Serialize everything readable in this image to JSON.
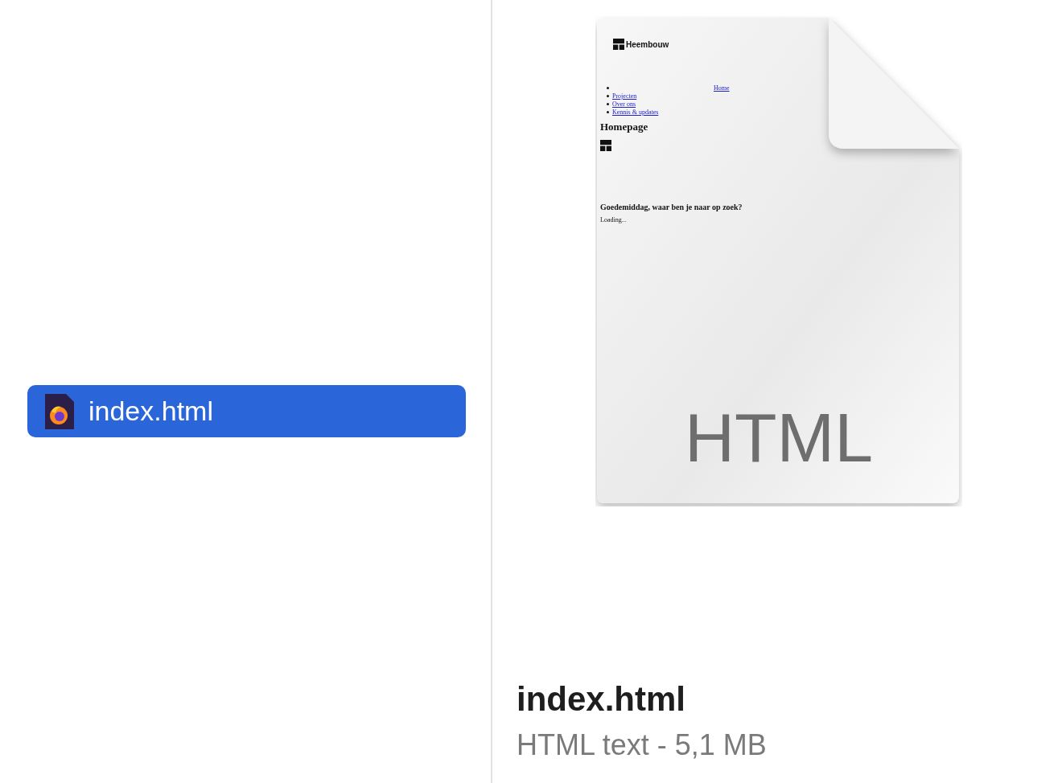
{
  "file_list": {
    "items": [
      {
        "name": "index.html",
        "selected": true
      }
    ]
  },
  "preview": {
    "thumbnail": {
      "logo_text": "Heembouw",
      "nav_links": [
        "Home",
        "Projecten",
        "Over ons",
        "Kennis & updates"
      ],
      "heading": "Homepage",
      "greeting": "Goedemiddag, waar ben je naar op zoek?",
      "loading": "Loading..."
    },
    "type_label": "HTML",
    "file_name": "index.html",
    "file_info": "HTML text - 5,1 MB"
  }
}
